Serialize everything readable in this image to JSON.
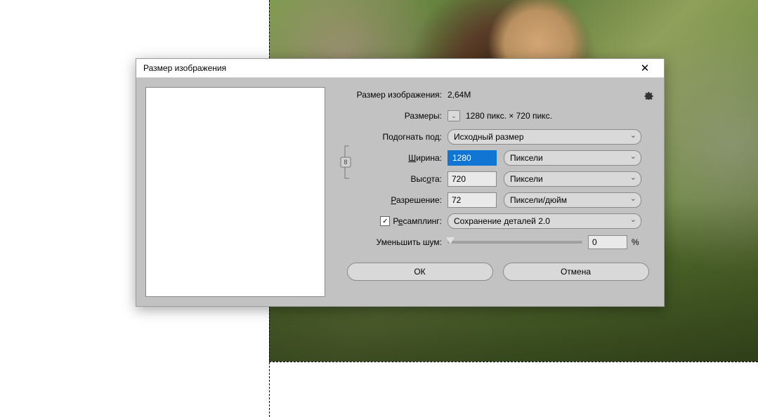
{
  "dialog": {
    "title": "Размер изображения",
    "image_size_label": "Размер изображения:",
    "image_size_value": "2,64M",
    "dimensions_label": "Размеры:",
    "dimensions_value": "1280 пикс.  ×  720 пикс.",
    "fit_to_label": "Подогнать под:",
    "fit_to_value": "Исходный размер",
    "width_label": "Ширина:",
    "width_value": "1280",
    "width_unit": "Пиксели",
    "height_label": "Высота:",
    "height_value": "720",
    "height_unit": "Пиксели",
    "resolution_label": "Разрешение:",
    "resolution_value": "72",
    "resolution_unit": "Пиксели/дюйм",
    "resample_label": "Ресамплинг:",
    "resample_value": "Сохранение деталей 2.0",
    "resample_checked": true,
    "noise_label": "Уменьшить шум:",
    "noise_value": "0",
    "noise_unit": "%",
    "ok": "ОК",
    "cancel": "Отмена",
    "underline": {
      "width_char": "Ш",
      "width_rest": "ирина:",
      "height_char": "о",
      "height_pre": "Выс",
      "height_post": "та:",
      "res_char": "Р",
      "res_rest": "азрешение:",
      "resamp_pre": "Р",
      "resamp_char": "е",
      "resamp_rest": "самплинг:"
    }
  }
}
